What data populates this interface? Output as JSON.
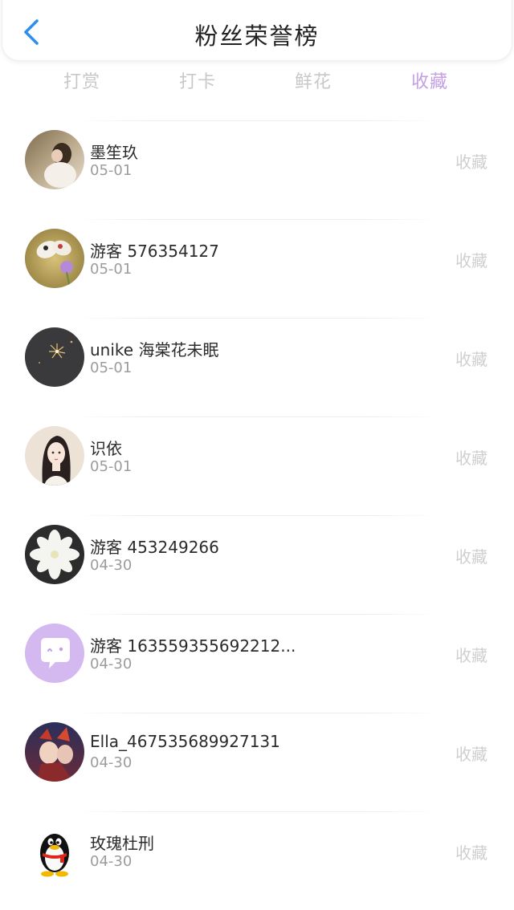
{
  "header": {
    "title": "粉丝荣誉榜",
    "back_icon": "chevron-left-icon"
  },
  "tabs": [
    {
      "label": "打赏",
      "active": false
    },
    {
      "label": "打卡",
      "active": false
    },
    {
      "label": "鲜花",
      "active": false
    },
    {
      "label": "收藏",
      "active": true
    }
  ],
  "colors": {
    "accent": "#c3a0e3",
    "back_icon": "#2f8ff0",
    "muted": "#c8c8c8"
  },
  "fans": [
    {
      "name": "墨笙玖",
      "date": "05-01",
      "action": "收藏",
      "avatar": "photo-avatar-girl-outdoors"
    },
    {
      "name": "游客 576354127",
      "date": "05-01",
      "action": "收藏",
      "avatar": "photo-avatar-butterfly"
    },
    {
      "name": "unike 海棠花未眠",
      "date": "05-01",
      "action": "收藏",
      "avatar": "photo-avatar-fireworks"
    },
    {
      "name": "识依",
      "date": "05-01",
      "action": "收藏",
      "avatar": "illustration-avatar-girl"
    },
    {
      "name": "游客 453249266",
      "date": "04-30",
      "action": "收藏",
      "avatar": "photo-avatar-white-flower"
    },
    {
      "name": "游客 163559355692212...",
      "date": "04-30",
      "action": "收藏",
      "avatar": "chat-bubble-default-avatar"
    },
    {
      "name": "Ella_467535689927131",
      "date": "04-30",
      "action": "收藏",
      "avatar": "illustration-avatar-anime"
    },
    {
      "name": "玫瑰杜刑",
      "date": "04-30",
      "action": "收藏",
      "avatar": "qq-penguin-avatar"
    }
  ]
}
